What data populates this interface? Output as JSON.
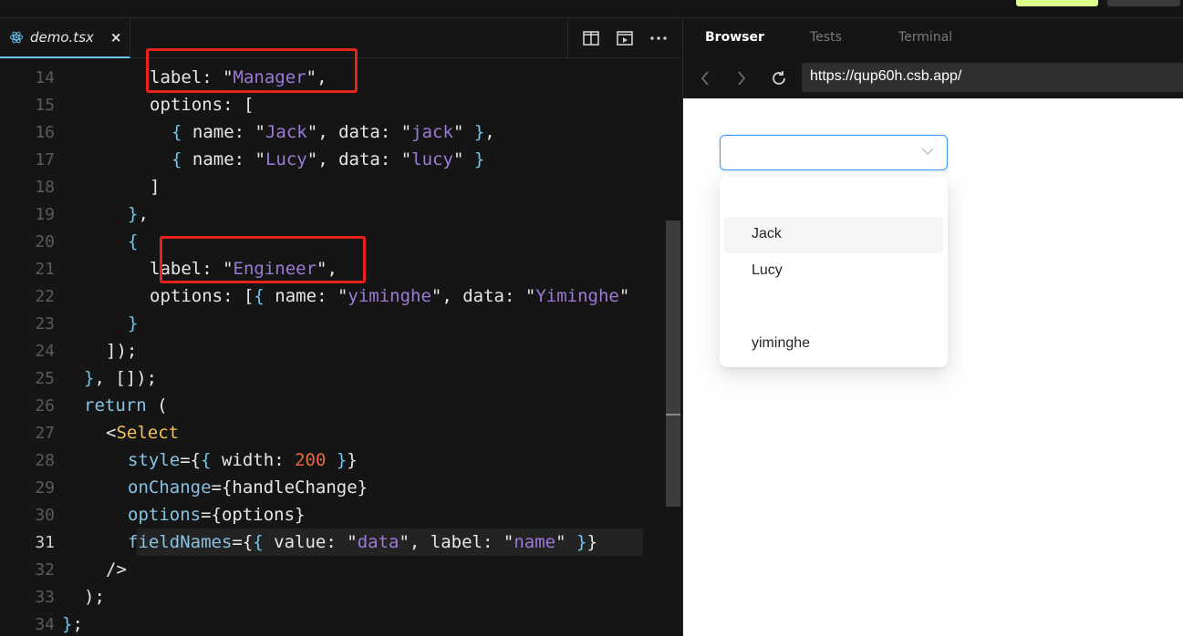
{
  "editor": {
    "file_tab": {
      "name": "demo.tsx",
      "close": "×"
    },
    "actions": [
      "split-editor-icon",
      "preview-icon",
      "more-icon"
    ],
    "lines": [
      {
        "num": "14",
        "tokens": [
          [
            "k",
            "label"
          ],
          [
            "p",
            ": "
          ],
          [
            "p",
            "\""
          ],
          [
            "s",
            "Manager"
          ],
          [
            "p",
            "\""
          ],
          [
            "p",
            ","
          ]
        ],
        "indent": 4
      },
      {
        "num": "15",
        "tokens": [
          [
            "k",
            "options"
          ],
          [
            "p",
            ": ["
          ]
        ],
        "indent": 4
      },
      {
        "num": "16",
        "tokens": [
          [
            "b",
            "{ "
          ],
          [
            "k",
            "name"
          ],
          [
            "p",
            ": \""
          ],
          [
            "s",
            "Jack"
          ],
          [
            "p",
            "\", "
          ],
          [
            "k",
            "data"
          ],
          [
            "p",
            ": \""
          ],
          [
            "s",
            "jack"
          ],
          [
            "p",
            "\" "
          ],
          [
            "b",
            "}"
          ],
          [
            "p",
            ","
          ]
        ],
        "indent": 5
      },
      {
        "num": "17",
        "tokens": [
          [
            "b",
            "{ "
          ],
          [
            "k",
            "name"
          ],
          [
            "p",
            ": \""
          ],
          [
            "s",
            "Lucy"
          ],
          [
            "p",
            "\", "
          ],
          [
            "k",
            "data"
          ],
          [
            "p",
            ": \""
          ],
          [
            "s",
            "lucy"
          ],
          [
            "p",
            "\" "
          ],
          [
            "b",
            "}"
          ]
        ],
        "indent": 5
      },
      {
        "num": "18",
        "tokens": [
          [
            "p",
            "]"
          ]
        ],
        "indent": 4
      },
      {
        "num": "19",
        "tokens": [
          [
            "b",
            "}"
          ],
          [
            "p",
            ","
          ]
        ],
        "indent": 3
      },
      {
        "num": "20",
        "tokens": [
          [
            "b",
            "{"
          ]
        ],
        "indent": 3
      },
      {
        "num": "21",
        "tokens": [
          [
            "k",
            "label"
          ],
          [
            "p",
            ": \""
          ],
          [
            "s",
            "Engineer"
          ],
          [
            "p",
            "\""
          ],
          [
            "p",
            ","
          ]
        ],
        "indent": 4
      },
      {
        "num": "22",
        "tokens": [
          [
            "k",
            "options"
          ],
          [
            "p",
            ": ["
          ],
          [
            "b",
            "{ "
          ],
          [
            "k",
            "name"
          ],
          [
            "p",
            ": \""
          ],
          [
            "s",
            "yiminghe"
          ],
          [
            "p",
            "\", "
          ],
          [
            "k",
            "data"
          ],
          [
            "p",
            ": \""
          ],
          [
            "s",
            "Yiminghe"
          ],
          [
            "p",
            "\""
          ]
        ],
        "indent": 4
      },
      {
        "num": "23",
        "tokens": [
          [
            "b",
            "}"
          ]
        ],
        "indent": 3
      },
      {
        "num": "24",
        "tokens": [
          [
            "p",
            "]);"
          ]
        ],
        "indent": 2
      },
      {
        "num": "25",
        "tokens": [
          [
            "b",
            "}"
          ],
          [
            "p",
            ", []);"
          ]
        ],
        "indent": 1
      },
      {
        "num": "26",
        "tokens": [
          [
            "kw",
            "return"
          ],
          [
            "p",
            " ("
          ]
        ],
        "indent": 1
      },
      {
        "num": "27",
        "tokens": [
          [
            "p",
            "<"
          ],
          [
            "y",
            "Select"
          ]
        ],
        "indent": 2
      },
      {
        "num": "28",
        "tokens": [
          [
            "attr",
            "style"
          ],
          [
            "p",
            "={"
          ],
          [
            "b",
            "{ "
          ],
          [
            "k",
            "width"
          ],
          [
            "p",
            ": "
          ],
          [
            "n",
            "200"
          ],
          [
            "b",
            " }"
          ],
          [
            "p",
            "}"
          ]
        ],
        "indent": 3
      },
      {
        "num": "29",
        "tokens": [
          [
            "attr",
            "onChange"
          ],
          [
            "p",
            "={handleChange}"
          ]
        ],
        "indent": 3
      },
      {
        "num": "30",
        "tokens": [
          [
            "attr",
            "options"
          ],
          [
            "p",
            "={options}"
          ]
        ],
        "indent": 3
      },
      {
        "num": "31",
        "tokens": [
          [
            "attr",
            "fieldNames"
          ],
          [
            "p",
            "={"
          ],
          [
            "b",
            "{ "
          ],
          [
            "k",
            "value"
          ],
          [
            "p",
            ": \""
          ],
          [
            "s",
            "data"
          ],
          [
            "p",
            "\", "
          ],
          [
            "k",
            "label"
          ],
          [
            "p",
            ": \""
          ],
          [
            "s",
            "name"
          ],
          [
            "p",
            "\" "
          ],
          [
            "b",
            "}"
          ],
          [
            "p",
            "}"
          ]
        ],
        "indent": 3,
        "active": true
      },
      {
        "num": "32",
        "tokens": [
          [
            "p",
            "/>"
          ]
        ],
        "indent": 2
      },
      {
        "num": "33",
        "tokens": [
          [
            "p",
            ");"
          ]
        ],
        "indent": 1
      },
      {
        "num": "34",
        "tokens": [
          [
            "b",
            "}"
          ],
          [
            "p",
            ";"
          ]
        ],
        "indent": 0
      }
    ]
  },
  "preview": {
    "tabs": [
      "Browser",
      "Tests",
      "Terminal"
    ],
    "url": "https://qup60h.csb.app/",
    "dropdown_options": [
      "Jack",
      "Lucy",
      "yiminghe"
    ]
  },
  "colors": {
    "accent": "#6cc7f6",
    "string": "#9b7ad8",
    "highlight_box": "#e8231b",
    "select_border": "#4096ff"
  }
}
